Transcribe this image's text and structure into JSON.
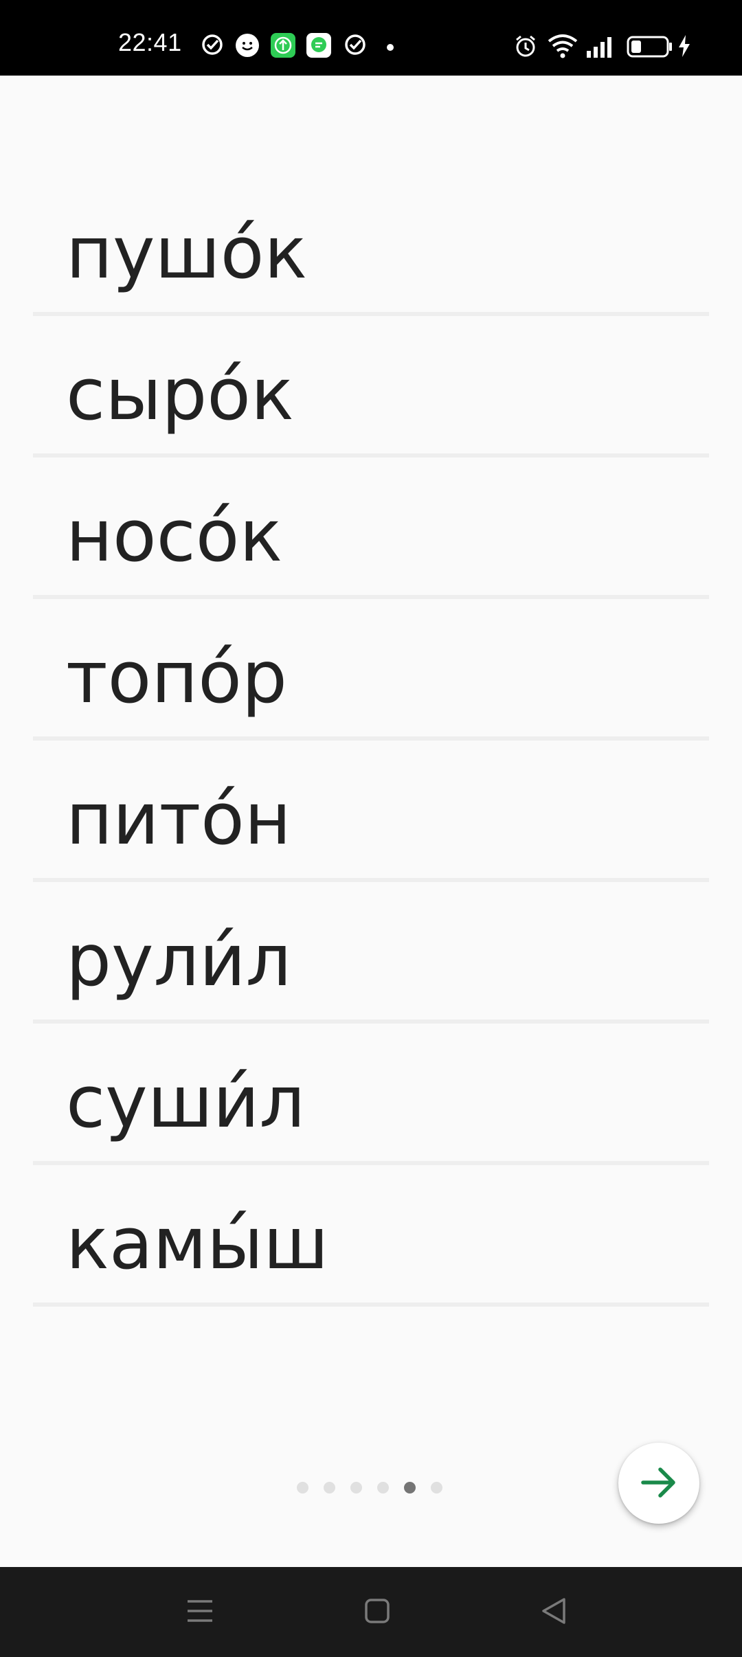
{
  "status_bar": {
    "time": "22:41",
    "notification_icons": [
      "task-done-icon",
      "smiley-app-icon",
      "upload-app-icon",
      "chat-app-icon",
      "task-done-icon",
      "more-dot-icon"
    ],
    "system_icons": [
      "alarm-icon",
      "wifi-icon",
      "signal-icon",
      "battery-icon",
      "charging-icon"
    ]
  },
  "words": [
    "пушо́к",
    "сыро́к",
    "носо́к",
    "топо́р",
    "пито́н",
    "рули́л",
    "суши́л",
    "камы́ш"
  ],
  "pager": {
    "total": 6,
    "current": 5
  },
  "next_button": {
    "icon": "arrow-right-icon",
    "color": "#1a8a4a"
  },
  "nav_bar": {
    "icons": [
      "menu-icon",
      "home-icon",
      "back-icon"
    ]
  }
}
